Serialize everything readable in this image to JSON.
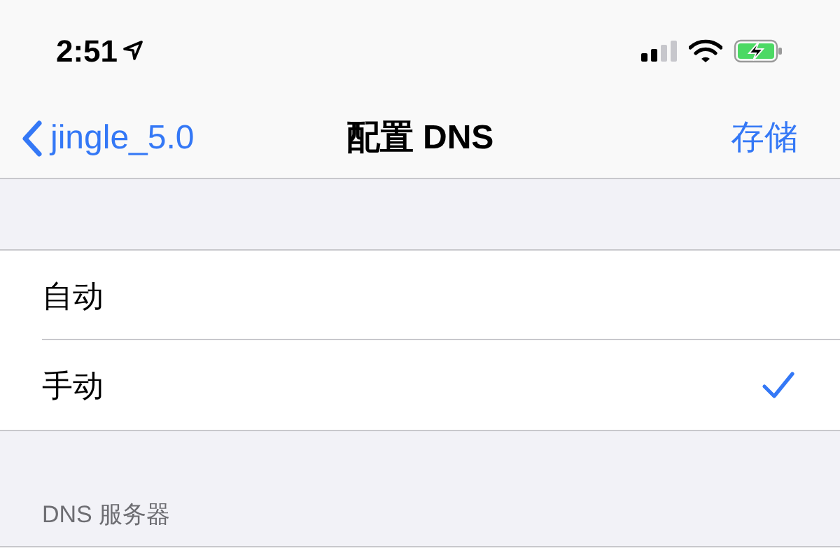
{
  "status_bar": {
    "time": "2:51"
  },
  "nav_bar": {
    "back_label": "jingle_5.0",
    "title": "配置 DNS",
    "action": "存储"
  },
  "options": [
    {
      "label": "自动",
      "selected": false
    },
    {
      "label": "手动",
      "selected": true
    }
  ],
  "section": {
    "header": "DNS 服务器"
  }
}
